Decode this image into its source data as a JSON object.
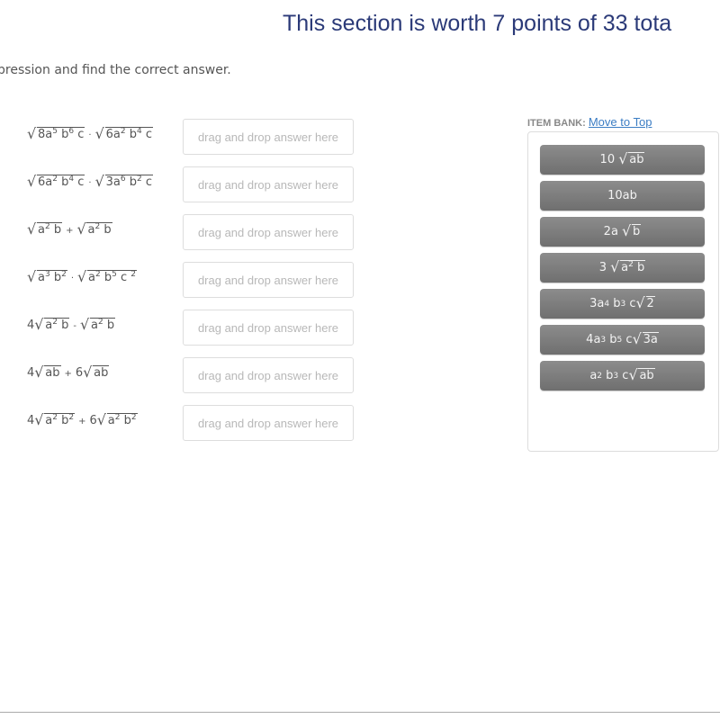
{
  "header": {
    "title": "This section is worth 7 points of 33 tota"
  },
  "instruction": "pression and find the correct answer.",
  "drop_placeholder": "drag and drop answer here",
  "questions": [
    {
      "id": 1,
      "expression": "√(8a⁵b⁶c) · √(6a²b⁴c)"
    },
    {
      "id": 2,
      "expression": "√(6a²b⁴c) · √(3a⁶b²c)"
    },
    {
      "id": 3,
      "expression": "√(a²b) + √(a²b)"
    },
    {
      "id": 4,
      "expression": "√(a³b²) · √(a²b⁵c²)"
    },
    {
      "id": 5,
      "expression": "4√(a²b) - √(a²b)"
    },
    {
      "id": 6,
      "expression": "4√(ab) + 6√(ab)"
    },
    {
      "id": 7,
      "expression": "4√(a²b²) + 6√(a²b²)"
    }
  ],
  "item_bank": {
    "label": "ITEM BANK:",
    "move_link": "Move to Top",
    "items": [
      "10√(ab)",
      "10ab",
      "2a√b",
      "3√(a²b)",
      "3a⁴b³c√2",
      "4a³b⁵c√(3a)",
      "a²b³c√(ab)"
    ]
  },
  "colors": {
    "title": "#2b3a78",
    "link": "#3b7dc4",
    "chip": "#7d7d7d"
  }
}
